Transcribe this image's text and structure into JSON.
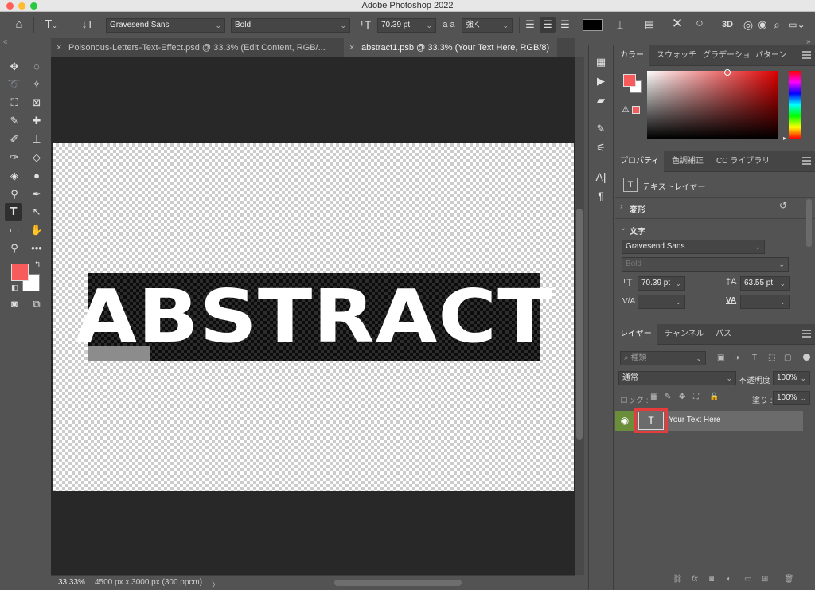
{
  "app": {
    "window_title": "Adobe Photoshop 2022"
  },
  "options_bar": {
    "font_family": "Gravesend Sans",
    "font_style": "Bold",
    "font_size": "70.39 pt",
    "aa_label": "a a",
    "antialias": "強く",
    "text_color": "#000000"
  },
  "doc_tabs": [
    {
      "label": "Poisonous-Letters-Text-Effect.psd @ 33.3% (Edit Content, RGB/...",
      "active": false
    },
    {
      "label": "abstract1.psb @ 33.3% (Your Text Here, RGB/8)",
      "active": true
    }
  ],
  "canvas": {
    "text": "ABSTRACT"
  },
  "status": {
    "zoom": "33.33%",
    "doc_info": "4500 px x 3000 px (300 ppcm)",
    "arrow": "〉"
  },
  "colors": {
    "foreground": "#f75b5b",
    "background": "#ffffff",
    "accent_highlight": "#e83b3b",
    "visibility_green": "#6b8e3a"
  },
  "color_panel": {
    "tabs": [
      "カラー",
      "スウォッチ",
      "グラデーショ",
      "パターン"
    ]
  },
  "properties_panel": {
    "tabs": [
      "プロパティ",
      "色調補正",
      "CC ライブラリ"
    ],
    "layer_type": "テキストレイヤー",
    "transform_label": "変形",
    "character_label": "文字",
    "font_family": "Gravesend Sans",
    "font_style": "Bold",
    "font_size": "70.39 pt",
    "leading": "63.55 pt",
    "kerning_label": "V/A",
    "tracking_label": "VA"
  },
  "layers_panel": {
    "tabs": [
      "レイヤー",
      "チャンネル",
      "パス"
    ],
    "search_placeholder": "種類",
    "blend_mode": "通常",
    "opacity_label": "不透明度 :",
    "opacity_value": "100%",
    "lock_label": "ロック :",
    "fill_label": "塗り :",
    "fill_value": "100%",
    "layers": [
      {
        "name": "Your Text Here",
        "type": "text",
        "visible": true
      }
    ]
  }
}
